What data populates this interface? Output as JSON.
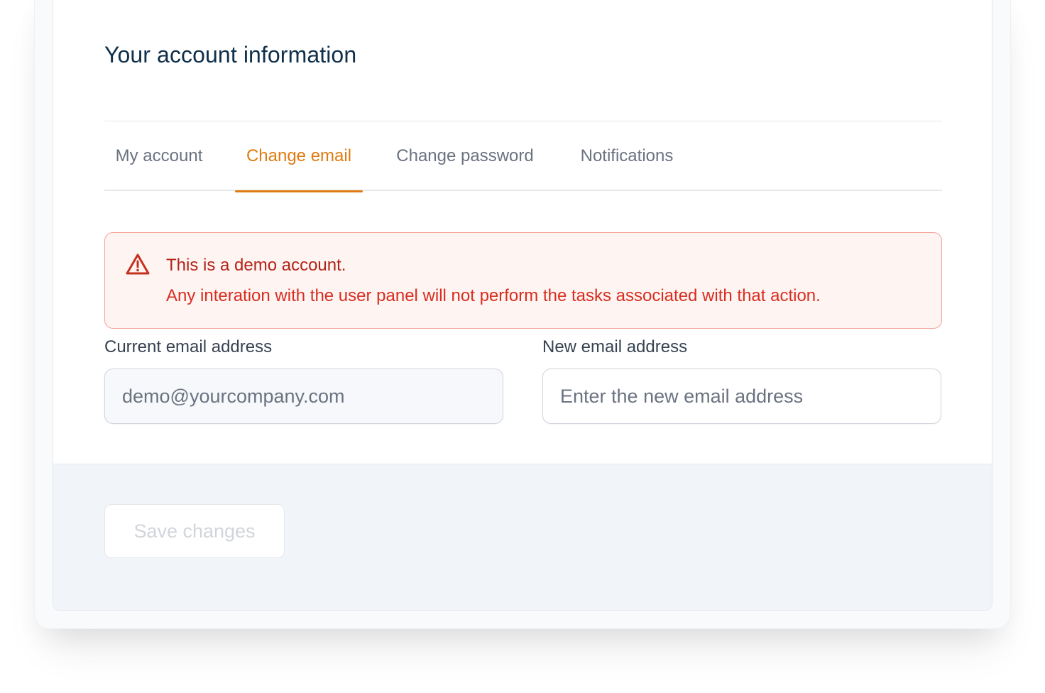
{
  "page": {
    "title": "Your account information"
  },
  "tabs": [
    {
      "label": "My account",
      "active": false
    },
    {
      "label": "Change email",
      "active": true
    },
    {
      "label": "Change password",
      "active": false
    },
    {
      "label": "Notifications",
      "active": false
    }
  ],
  "alert": {
    "icon": "warning-triangle-icon",
    "title": "This is a demo account.",
    "message": "Any interation with the user panel will not perform the tasks associated with that action."
  },
  "form": {
    "current_email": {
      "label": "Current email address",
      "value": "demo@yourcompany.com"
    },
    "new_email": {
      "label": "New email address",
      "placeholder": "Enter the new email address",
      "value": ""
    }
  },
  "footer": {
    "save_label": "Save changes",
    "save_disabled": true
  },
  "colors": {
    "accent": "#e07b12",
    "title": "#0f2f4a",
    "alert_text": "#d92d20",
    "alert_bg": "#fef4f2",
    "alert_border": "#f6a39a",
    "footer_bg": "#f1f5f9"
  }
}
